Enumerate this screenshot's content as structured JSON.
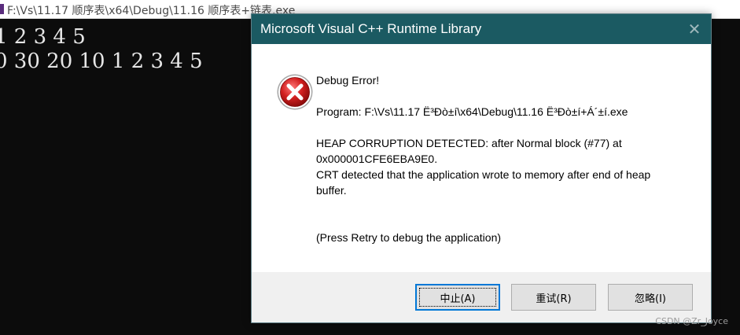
{
  "console": {
    "title": "F:\\Vs\\11.17 顺序表\\x64\\Debug\\11.16 顺序表+链表.exe",
    "lines": [
      "1 2 3 4 5",
      "0 30 20 10 1 2 3 4 5"
    ]
  },
  "dialog": {
    "title": "Microsoft Visual C++ Runtime Library",
    "close_glyph": "✕",
    "icon": "error-icon",
    "message": {
      "heading": "Debug Error!",
      "program": "Program: F:\\Vs\\11.17 Ë³Ðò±í\\x64\\Debug\\11.16 Ë³Ðò±í+Á´±í.exe",
      "detail_1": "HEAP CORRUPTION DETECTED: after Normal block (#77) at",
      "detail_2": "0x000001CFE6EBA9E0.",
      "detail_3": "CRT detected that the application wrote to memory after end of heap",
      "detail_4": "buffer.",
      "hint": "(Press Retry to debug the application)"
    },
    "buttons": {
      "abort": "中止(A)",
      "retry": "重试(R)",
      "ignore": "忽略(I)"
    }
  },
  "watermark": "CSDN @Zr_Joyce",
  "colors": {
    "dialog_titlebar": "#1b5a62",
    "console_bg": "#0c0c0c",
    "error_red": "#d11f1f",
    "focus_blue": "#0078d7"
  }
}
